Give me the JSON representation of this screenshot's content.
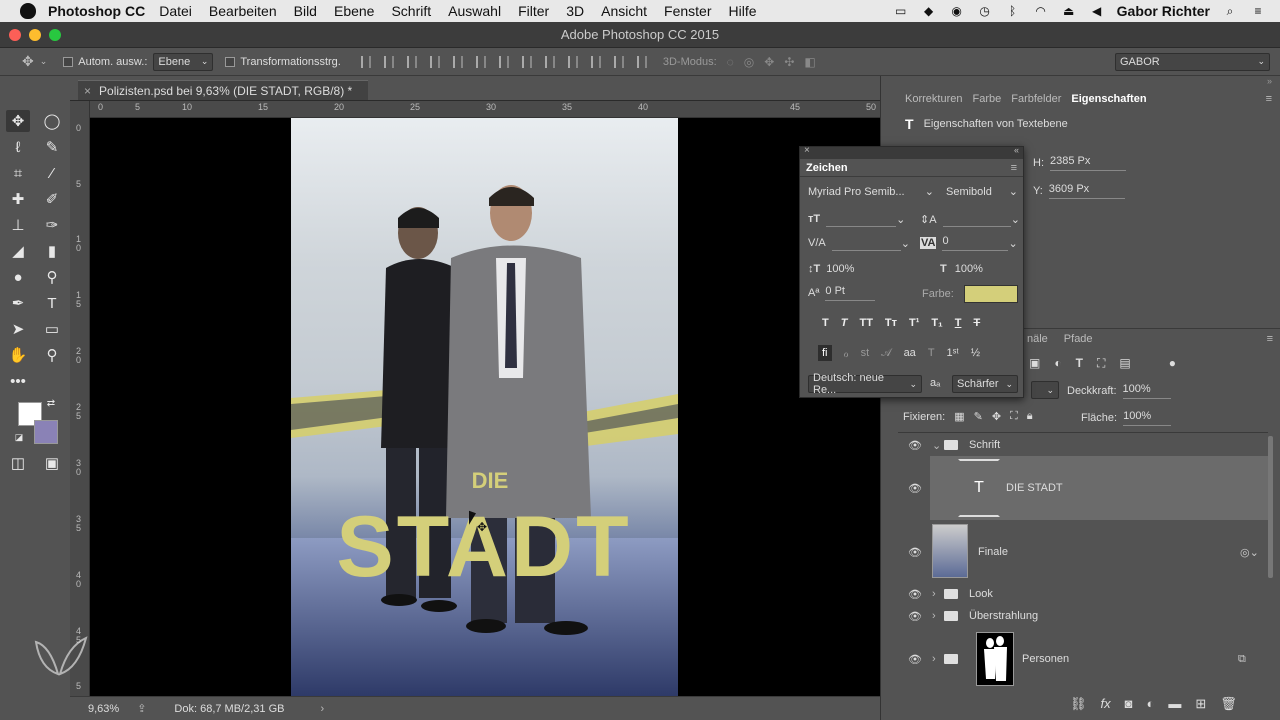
{
  "mac_menu": {
    "app": "Photoshop CC",
    "items": [
      "Datei",
      "Bearbeiten",
      "Bild",
      "Ebene",
      "Schrift",
      "Auswahl",
      "Filter",
      "3D",
      "Ansicht",
      "Fenster",
      "Hilfe"
    ],
    "user": "Gabor Richter"
  },
  "window_title": "Adobe Photoshop CC 2015",
  "options_bar": {
    "auto_select_label": "Autom. ausw.:",
    "auto_select_value": "Ebene",
    "transform_label": "Transformationsstrg.",
    "mode_3d_label": "3D-Modus:",
    "workspace": "GABOR"
  },
  "document": {
    "tab_label": "Polizisten.psd bei 9,63% (DIE STADT, RGB/8) *",
    "ruler_top": [
      "0",
      "5",
      "10",
      "15",
      "20",
      "25",
      "30",
      "35",
      "40",
      "45",
      "50"
    ],
    "ruler_left": [
      "0",
      "5",
      "1 0",
      "1 5",
      "2 0",
      "2 5",
      "3 0",
      "3 5",
      "4 0",
      "4 5",
      "5"
    ],
    "poster_text_die": "DIE",
    "poster_text_stadt": "STADT"
  },
  "status": {
    "zoom": "9,63%",
    "doc_info": "Dok: 68,7 MB/2,31 GB"
  },
  "properties_panel": {
    "tabs": [
      "Korrekturen",
      "Farbe",
      "Farbfelder",
      "Eigenschaften"
    ],
    "header": "Eigenschaften von Textebene",
    "h_label": "H:",
    "h_value": "2385 Px",
    "y_label": "Y:",
    "y_value": "3609 Px"
  },
  "character_panel": {
    "title": "Zeichen",
    "font_family": "Myriad Pro Semib...",
    "font_style": "Semibold",
    "tracking_value": "0",
    "vertical_scale": "100%",
    "horizontal_scale": "100%",
    "baseline_shift": "0 Pt",
    "color_label": "Farbe:",
    "color_value": "#d4cf7a",
    "language": "Deutsch: neue Re...",
    "antialias_label": "aₐ",
    "antialias_value": "Schärfer"
  },
  "layers_panel": {
    "tabs_partial": [
      "näle",
      "Pfade"
    ],
    "opacity_label": "Deckkraft:",
    "opacity_value": "100%",
    "lock_label": "Fixieren:",
    "fill_label": "Fläche:",
    "fill_value": "100%",
    "layers": [
      {
        "name": "Schrift",
        "type": "group",
        "expanded": true
      },
      {
        "name": "DIE STADT",
        "type": "text",
        "selected": true
      },
      {
        "name": "Finale",
        "type": "smart"
      },
      {
        "name": "Look",
        "type": "group"
      },
      {
        "name": "Überstrahlung",
        "type": "group"
      },
      {
        "name": "Personen",
        "type": "group-mask"
      }
    ]
  },
  "colors": {
    "foreground": "#ffffff",
    "background": "#8a82b6",
    "poster_text": "#d4cf7a"
  }
}
